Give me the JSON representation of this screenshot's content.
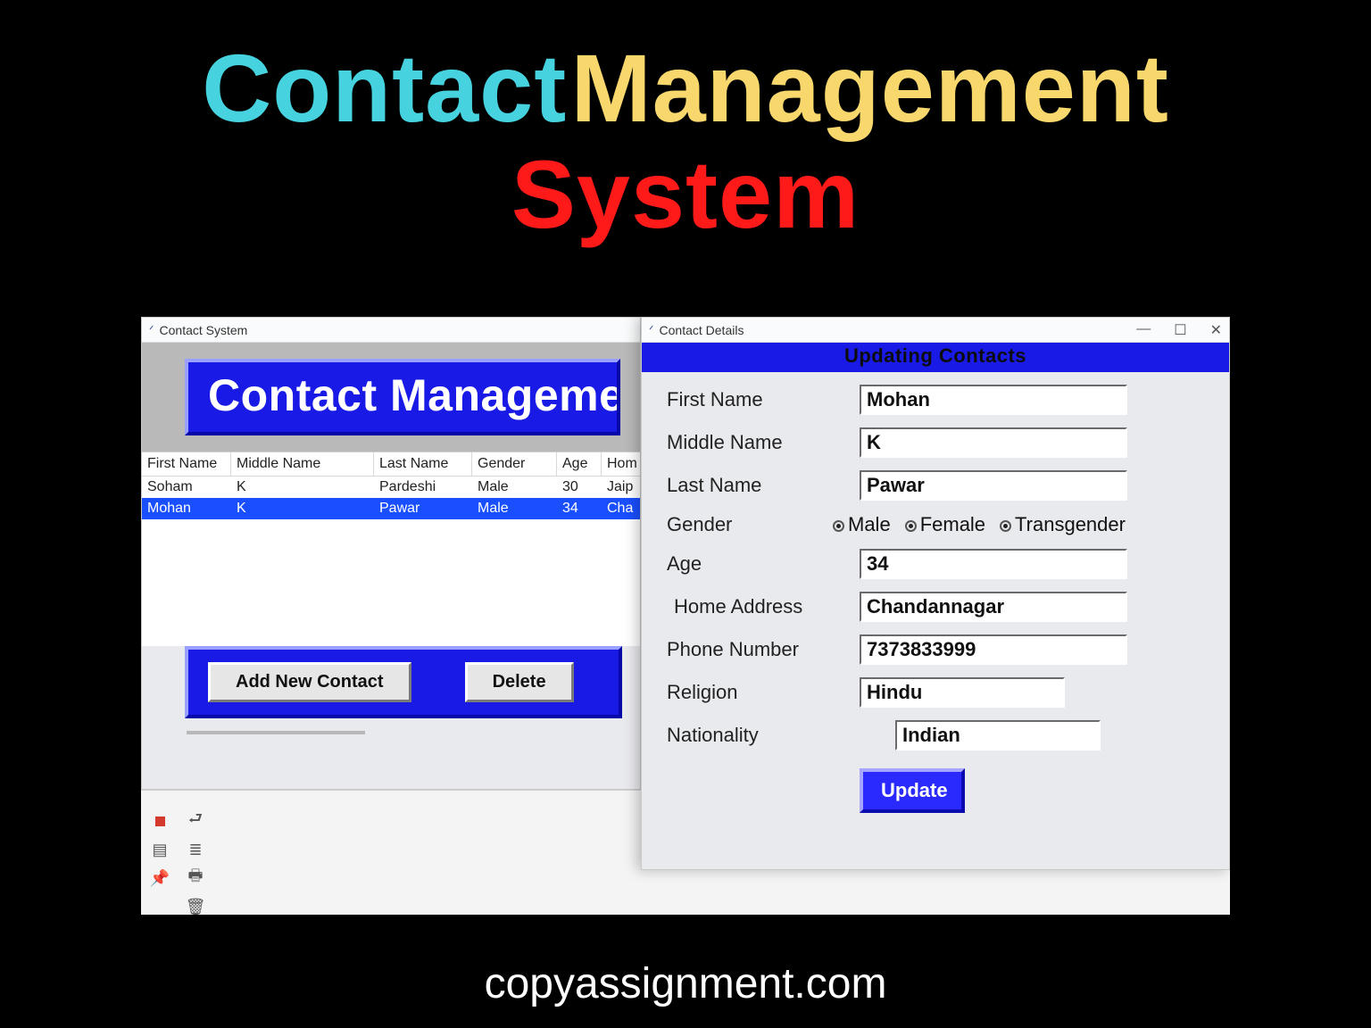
{
  "hero": {
    "w1": "Contact",
    "w2": "Management",
    "w3": "System"
  },
  "footer": "copyassignment.com",
  "main_window": {
    "title": "Contact System",
    "banner": "Contact Manageme",
    "columns": [
      "First Name",
      "Middle Name",
      "Last Name",
      "Gender",
      "Age",
      "Hom"
    ],
    "rows": [
      {
        "first": "Soham",
        "middle": "K",
        "last": "Pardeshi",
        "gender": "Male",
        "age": "30",
        "home": "Jaip",
        "selected": false
      },
      {
        "first": "Mohan",
        "middle": "K",
        "last": "Pawar",
        "gender": "Male",
        "age": "34",
        "home": "Cha",
        "selected": true
      }
    ],
    "buttons": {
      "add": "Add New Contact",
      "delete": "Delete"
    }
  },
  "details_window": {
    "title": "Contact Details",
    "banner": "Updating Contacts",
    "fields": {
      "first_name": {
        "label": "First Name",
        "value": "Mohan"
      },
      "middle_name": {
        "label": "Middle Name",
        "value": "K"
      },
      "last_name": {
        "label": "Last Name",
        "value": "Pawar"
      },
      "gender": {
        "label": "Gender",
        "options": [
          "Male",
          "Female",
          "Transgender"
        ],
        "selected": "Male"
      },
      "age": {
        "label": "Age",
        "value": "34"
      },
      "home_address": {
        "label": "Home Address",
        "value": "Chandannagar"
      },
      "phone": {
        "label": "Phone Number",
        "value": "7373833999"
      },
      "religion": {
        "label": "Religion",
        "value": "Hindu"
      },
      "nationality": {
        "label": "Nationality",
        "value": "Indian"
      }
    },
    "update_label": "Update",
    "window_controls": {
      "min": "—",
      "max": "☐",
      "close": "✕"
    }
  }
}
